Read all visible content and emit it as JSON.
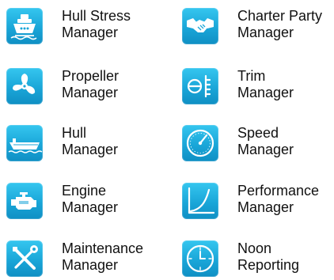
{
  "modules": [
    {
      "icon": "ship-icon",
      "line1": "Hull Stress",
      "line2": "Manager"
    },
    {
      "icon": "handshake-icon",
      "line1": "Charter Party",
      "line2": "Manager"
    },
    {
      "icon": "propeller-icon",
      "line1": "Propeller",
      "line2": "Manager"
    },
    {
      "icon": "trim-icon",
      "line1": "Trim",
      "line2": "Manager"
    },
    {
      "icon": "hull-icon",
      "line1": "Hull",
      "line2": "Manager"
    },
    {
      "icon": "speedometer-icon",
      "line1": "Speed",
      "line2": "Manager"
    },
    {
      "icon": "engine-icon",
      "line1": "Engine",
      "line2": "Manager"
    },
    {
      "icon": "performance-curve-icon",
      "line1": "Performance",
      "line2": "Manager"
    },
    {
      "icon": "tools-icon",
      "line1": "Maintenance",
      "line2": "Manager"
    },
    {
      "icon": "clock-icon",
      "line1": "Noon",
      "line2": "Reporting"
    }
  ],
  "colors": {
    "tile_top": "#35c6ef",
    "tile_bottom": "#0f8fc4",
    "text": "#111111"
  }
}
